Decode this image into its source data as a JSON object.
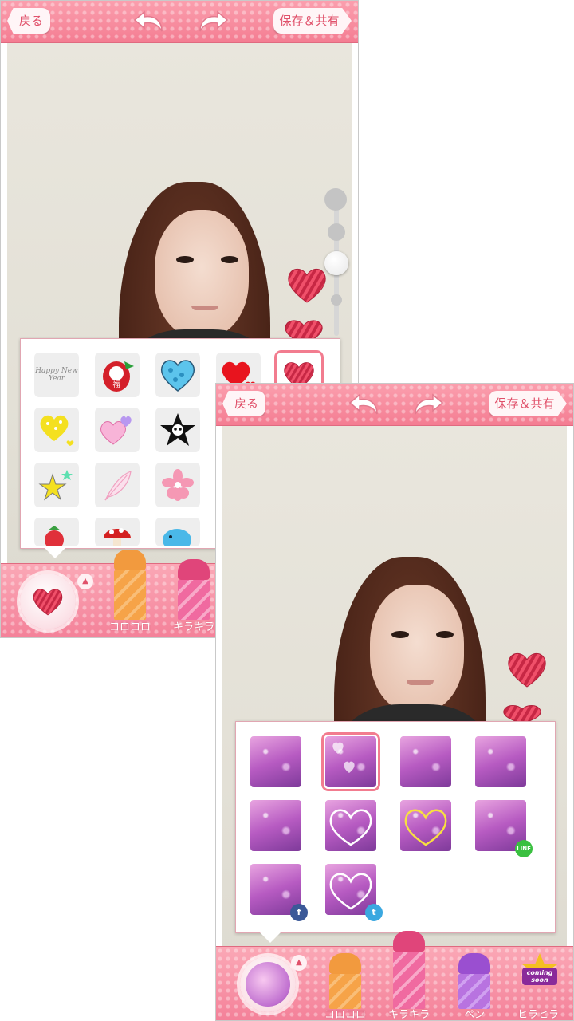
{
  "screen1": {
    "topbar": {
      "back_label": "戻る",
      "save_label": "保存＆共有"
    },
    "stickers": [
      {
        "name": "happy-new-year-sticker",
        "glyph": "Happy New Year"
      },
      {
        "name": "daruma-sticker",
        "glyph": "福"
      },
      {
        "name": "blue-polka-heart-sticker",
        "glyph": "♥"
      },
      {
        "name": "red-hearts-sticker",
        "glyph": "♥"
      },
      {
        "name": "striped-heart-sticker",
        "glyph": "♥"
      },
      {
        "name": "yellow-heart-sticker",
        "glyph": "♥"
      },
      {
        "name": "pink-hearts-sticker",
        "glyph": "♥"
      },
      {
        "name": "skull-star-sticker",
        "glyph": "★"
      },
      {
        "name": "yellow-star-sticker",
        "glyph": "★"
      },
      {
        "name": "feather-sticker",
        "glyph": "❦"
      },
      {
        "name": "sakura-sticker",
        "glyph": "✿"
      },
      {
        "name": "strawberry-sticker",
        "glyph": "●"
      },
      {
        "name": "mushroom-sticker",
        "glyph": "▲"
      },
      {
        "name": "blue-elephant-sticker",
        "glyph": "●"
      }
    ],
    "tools": [
      {
        "label": "コロコロ",
        "cap": "#f29a3e",
        "body": "#f6a348"
      },
      {
        "label": "キラキラ",
        "cap": "#e0457a",
        "body": "#f06aa0"
      }
    ]
  },
  "screen2": {
    "topbar": {
      "back_label": "戻る",
      "save_label": "保存＆共有"
    },
    "effects": [
      {
        "name": "effect-bokeh-1",
        "badge": ""
      },
      {
        "name": "effect-hearts-bokeh",
        "badge": ""
      },
      {
        "name": "effect-bokeh-2",
        "badge": ""
      },
      {
        "name": "effect-bokeh-3",
        "badge": ""
      },
      {
        "name": "effect-bokeh-4",
        "badge": ""
      },
      {
        "name": "effect-love-heart",
        "badge": ""
      },
      {
        "name": "effect-love-heart-gold",
        "badge": ""
      },
      {
        "name": "effect-stars-line",
        "badge": "LINE"
      },
      {
        "name": "effect-stars-facebook",
        "badge": "f"
      },
      {
        "name": "effect-love-twitter",
        "badge": "t"
      }
    ],
    "tools": [
      {
        "label": "コロコロ",
        "cap": "#f29a3e",
        "body": "#f6a348"
      },
      {
        "label": "キラキラ",
        "cap": "#e0457a",
        "body": "#f06aa0"
      },
      {
        "label": "ペン",
        "cap": "#9a4fd0",
        "body": "#b873e0"
      },
      {
        "label": "ヒラヒラ",
        "cap": "#e05a88",
        "body": "#f27da8"
      }
    ],
    "coming_soon": "coming soon"
  },
  "colors": {
    "accent_pink": "#f27c8f",
    "bar_pink": "#f48199",
    "text_pink": "#e0506a"
  }
}
